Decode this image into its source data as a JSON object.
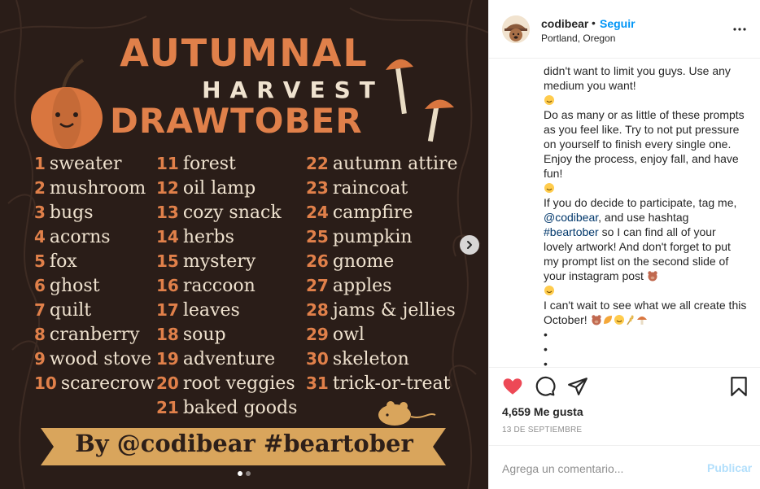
{
  "artwork": {
    "title_line1": "AUTUMNAL",
    "title_line2": "HARVEST",
    "title_line3": "DRAWTOBER",
    "prompts_col1": [
      {
        "num": "1",
        "text": "sweater"
      },
      {
        "num": "2",
        "text": "mushroom"
      },
      {
        "num": "3",
        "text": "bugs"
      },
      {
        "num": "4",
        "text": "acorns"
      },
      {
        "num": "5",
        "text": "fox"
      },
      {
        "num": "6",
        "text": "ghost"
      },
      {
        "num": "7",
        "text": "quilt"
      },
      {
        "num": "8",
        "text": "cranberry"
      },
      {
        "num": "9",
        "text": "wood stove"
      },
      {
        "num": "10",
        "text": "scarecrow"
      }
    ],
    "prompts_col2": [
      {
        "num": "11",
        "text": "forest"
      },
      {
        "num": "12",
        "text": "oil lamp"
      },
      {
        "num": "13",
        "text": "cozy snack"
      },
      {
        "num": "14",
        "text": "herbs"
      },
      {
        "num": "15",
        "text": "mystery"
      },
      {
        "num": "16",
        "text": "raccoon"
      },
      {
        "num": "17",
        "text": "leaves"
      },
      {
        "num": "18",
        "text": "soup"
      },
      {
        "num": "19",
        "text": "adventure"
      },
      {
        "num": "20",
        "text": "root veggies"
      },
      {
        "num": "21",
        "text": "baked goods"
      }
    ],
    "prompts_col3": [
      {
        "num": "22",
        "text": "autumn attire"
      },
      {
        "num": "23",
        "text": "raincoat"
      },
      {
        "num": "24",
        "text": "campfire"
      },
      {
        "num": "25",
        "text": "pumpkin"
      },
      {
        "num": "26",
        "text": "gnome"
      },
      {
        "num": "27",
        "text": "apples"
      },
      {
        "num": "28",
        "text": "jams & jellies"
      },
      {
        "num": "29",
        "text": "owl"
      },
      {
        "num": "30",
        "text": "skeleton"
      },
      {
        "num": "31",
        "text": "trick-or-treat"
      }
    ],
    "banner": "By @codibear #beartober"
  },
  "carousel": {
    "slide_count": 2,
    "active_index": 0
  },
  "header": {
    "username": "codibear",
    "separator": "•",
    "follow_label": "Seguir",
    "location": "Portland, Oregon"
  },
  "caption": {
    "p1": "didn't want to limit you guys. Use any medium you want!",
    "p2": "Do as many or as little of these prompts as you feel like. Try to not put pressure on yourself to finish every single one. Enjoy the process, enjoy fall, and have fun!",
    "p3_a": "If you do decide to participate, tag me, ",
    "p3_mention": "@codibear",
    "p3_b": ", and use hashtag ",
    "p3_hashtag": "#beartober",
    "p3_c": " so I can find all of your lovely artwork! And don't forget to put my prompt list on the second slide of your instagram post",
    "p4": "I can't wait to see what we all create this October!",
    "bullet": "•"
  },
  "stats": {
    "likes": "4,659 Me gusta",
    "date": "13 DE SEPTIEMBRE"
  },
  "comment": {
    "placeholder": "Agrega un comentario...",
    "post_label": "Publicar"
  },
  "colors": {
    "background": "#2a1d18",
    "orange": "#e0804a",
    "cream": "#efe2cf",
    "like_red": "#ed4956",
    "follow_blue": "#0095f6",
    "post_disabled": "#b2dffc"
  }
}
